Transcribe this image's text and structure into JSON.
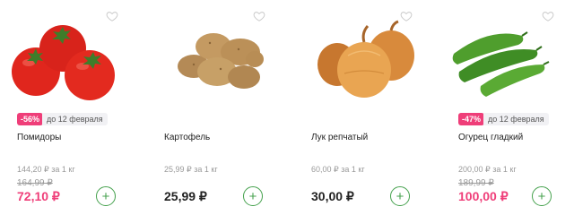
{
  "products": [
    {
      "name": "Помидоры",
      "image_icon": "tomatoes-image",
      "discount": "-56%",
      "promo_until": "до 12 февраля",
      "unit_price": "144,20 ₽ за 1 кг",
      "old_price": "164,99 ₽",
      "price": "72,10 ₽",
      "on_sale": true
    },
    {
      "name": "Картофель",
      "image_icon": "potatoes-image",
      "unit_price": "25,99 ₽ за 1 кг",
      "price": "25,99 ₽",
      "on_sale": false
    },
    {
      "name": "Лук репчатый",
      "image_icon": "onions-image",
      "unit_price": "60,00 ₽ за 1 кг",
      "price": "30,00 ₽",
      "on_sale": false
    },
    {
      "name": "Огурец гладкий",
      "image_icon": "cucumbers-image",
      "discount": "-47%",
      "promo_until": "до 12 февраля",
      "unit_price": "200,00 ₽ за 1 кг",
      "old_price": "189,99 ₽",
      "price": "100,00 ₽",
      "on_sale": true
    }
  ],
  "add_button_symbol": "+",
  "favorite_icon": "heart-outline-icon",
  "colors": {
    "sale_accent": "#ef3e79",
    "add_button": "#45a14d",
    "muted_text": "#9a9a9a"
  }
}
